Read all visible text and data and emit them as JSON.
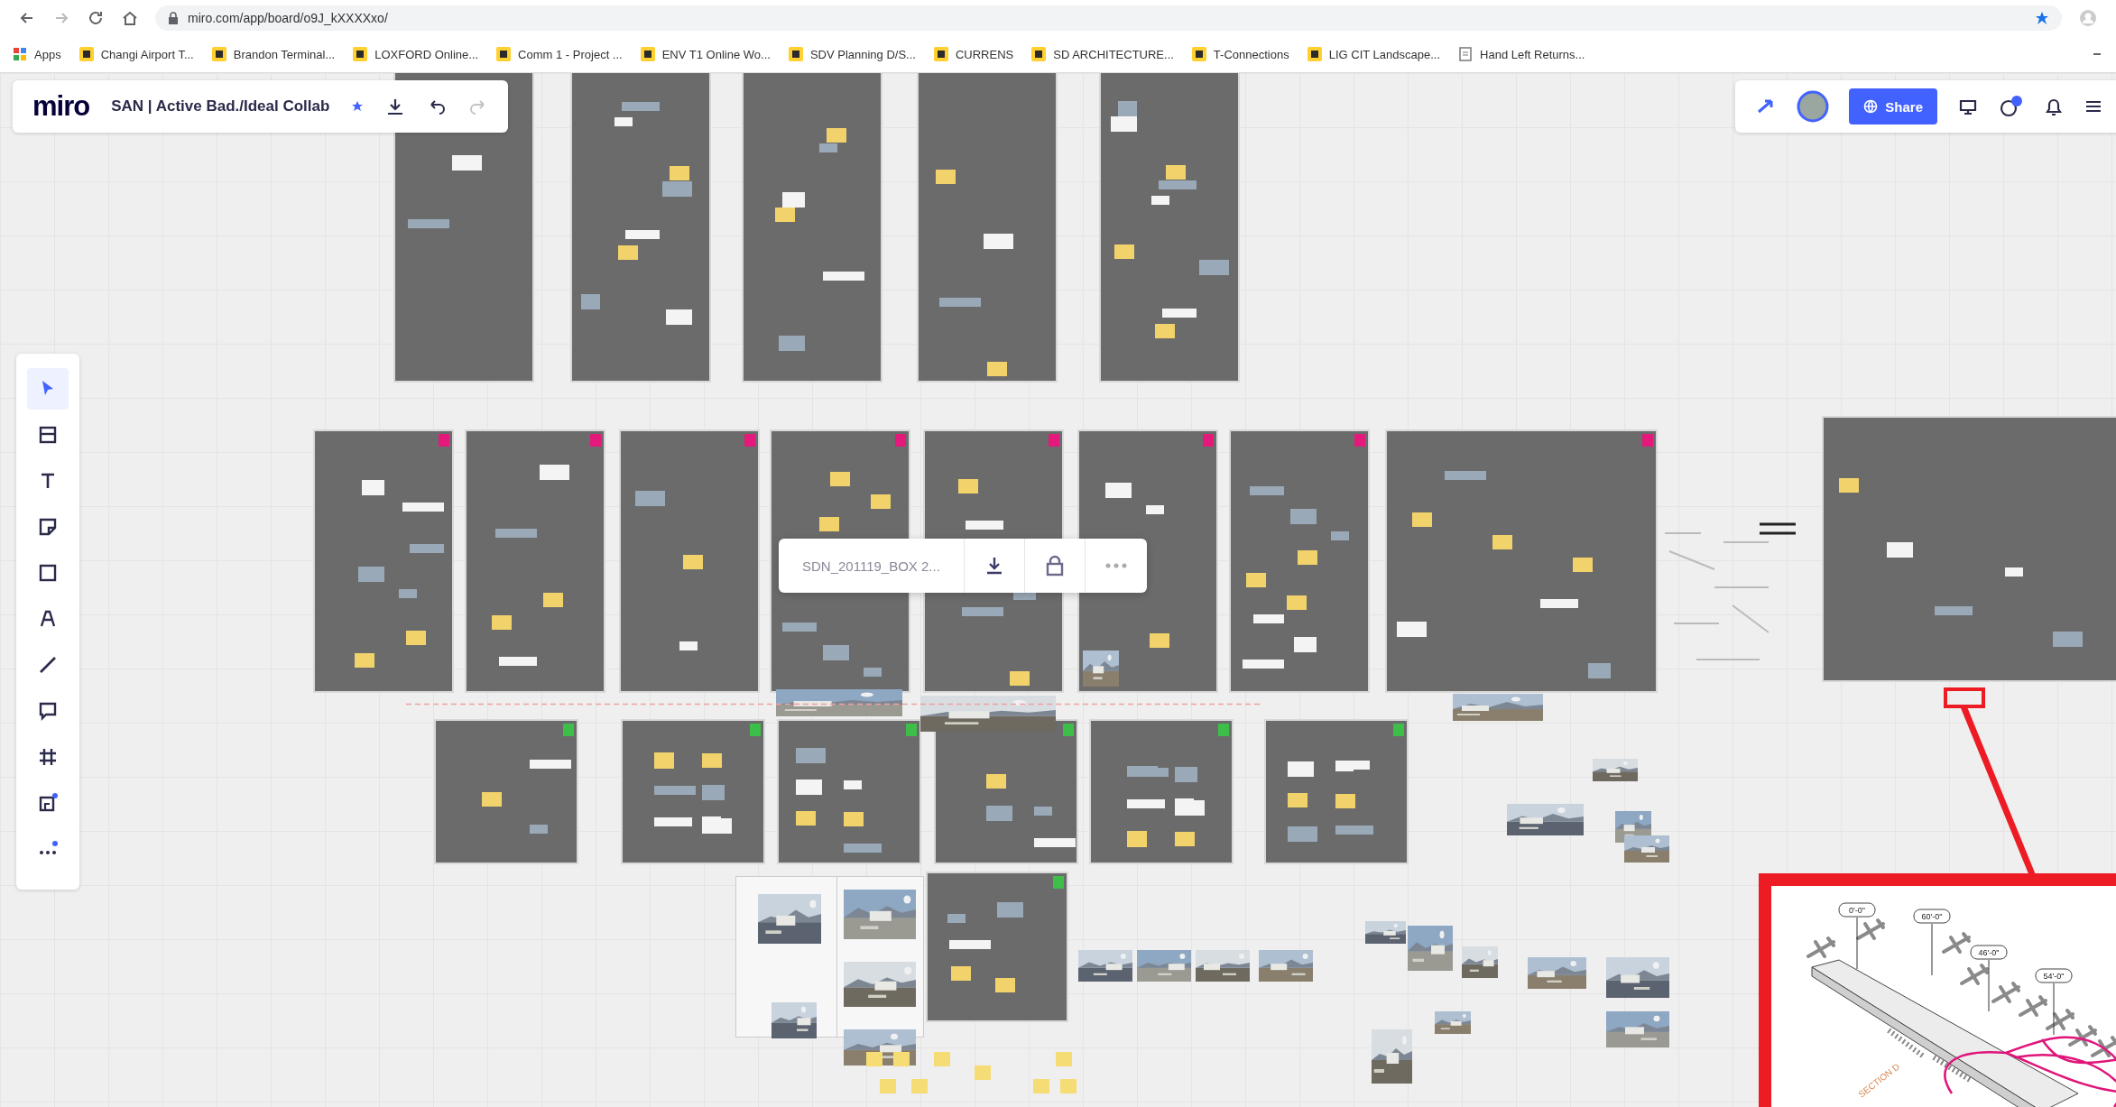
{
  "browser": {
    "url": "miro.com/app/board/o9J_kXXXXxo/"
  },
  "bookmarks": [
    {
      "label": "Apps",
      "kind": "apps"
    },
    {
      "label": "Changi Airport T...",
      "kind": "board"
    },
    {
      "label": "Brandon Terminal...",
      "kind": "board"
    },
    {
      "label": "LOXFORD Online...",
      "kind": "board"
    },
    {
      "label": "Comm 1 - Project ...",
      "kind": "board"
    },
    {
      "label": "ENV T1 Online Wo...",
      "kind": "board"
    },
    {
      "label": "SDV Planning D/S...",
      "kind": "board"
    },
    {
      "label": "CURRENS",
      "kind": "board"
    },
    {
      "label": "SD ARCHITECTURE...",
      "kind": "board"
    },
    {
      "label": "T-Connections",
      "kind": "board"
    },
    {
      "label": "LIG CIT Landscape...",
      "kind": "board"
    },
    {
      "label": "Hand Left Returns...",
      "kind": "page"
    }
  ],
  "board": {
    "logo": "miro",
    "title": "SAN | Active Bad./Ideal Collab",
    "starred": true
  },
  "share": {
    "label": "Share"
  },
  "tools": [
    {
      "kind": "select",
      "selected": true
    },
    {
      "kind": "templates",
      "selected": false
    },
    {
      "kind": "text",
      "selected": false
    },
    {
      "kind": "sticky",
      "selected": false
    },
    {
      "kind": "shape",
      "selected": false
    },
    {
      "kind": "pen",
      "selected": false
    },
    {
      "kind": "line",
      "selected": false
    },
    {
      "kind": "comment",
      "selected": false
    },
    {
      "kind": "frame",
      "selected": false
    },
    {
      "kind": "upload",
      "selected": false
    },
    {
      "kind": "more",
      "selected": false
    }
  ],
  "file_toolbar": {
    "filename": "SDN_201119_BOX 2..."
  },
  "inset": {
    "labels": [
      "0'-0\"",
      "60'-0\"",
      "46'-0\"",
      "54'-0\""
    ],
    "section": "SECTION D"
  }
}
